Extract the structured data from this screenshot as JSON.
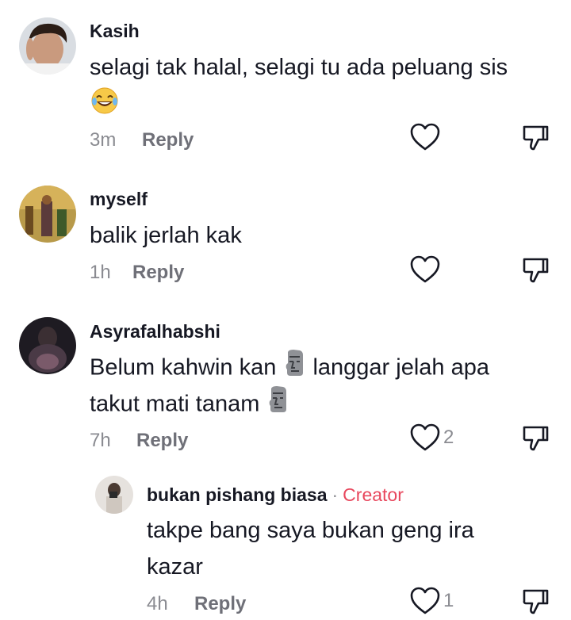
{
  "comments": [
    {
      "username": "Kasih",
      "text_line1": "selagi tak halal, selagi tu ada peluang sis",
      "emoji": "laughing-with-tears-emoji",
      "time": "3m",
      "reply_label": "Reply",
      "likes": ""
    },
    {
      "username": "myself",
      "text_line1": "balik jerlah kak",
      "time": "1h",
      "reply_label": "Reply",
      "likes": ""
    },
    {
      "username": "Asyrafalhabshi",
      "text_line1a": "Belum kahwin kan",
      "text_line1b": "langgar jelah apa",
      "text_line2": "takut mati tanam",
      "emoji": "moai-emoji",
      "time": "7h",
      "reply_label": "Reply",
      "likes": "2"
    },
    {
      "username": "bukan pishang biasa",
      "creator_label": "Creator",
      "text_line1": "takpe bang saya bukan geng ira",
      "text_line2": "kazar",
      "time": "4h",
      "reply_label": "Reply",
      "likes": "1"
    }
  ],
  "icons": {
    "like": "heart-outline-icon",
    "dislike": "thumbs-down-outline-icon"
  },
  "colors": {
    "text": "#161823",
    "meta": "#8a8b91",
    "creator": "#e8475d",
    "icon": "#161823"
  }
}
